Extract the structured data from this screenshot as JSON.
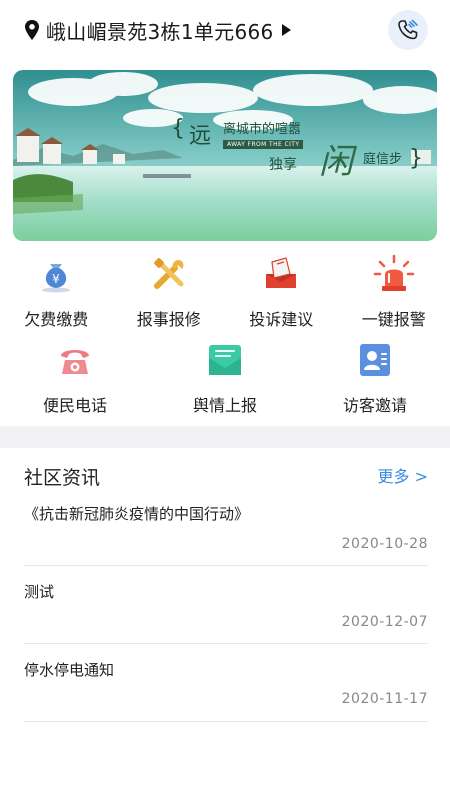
{
  "header": {
    "location": "峨山嵋景苑3栋1单元666"
  },
  "banner": {
    "text_brace_left": "{",
    "text_yuan": "远",
    "text_small": "离城市的喧嚣",
    "text_english": "AWAY FROM THE CITY",
    "text_duxiang": "独享",
    "text_xian": "闲",
    "text_tingxinbu": "庭信步",
    "text_brace_right": "}"
  },
  "services_row1": [
    {
      "label": "欠费缴费",
      "icon": "money-bag-icon"
    },
    {
      "label": "报事报修",
      "icon": "tools-icon"
    },
    {
      "label": "投诉建议",
      "icon": "feedback-icon"
    },
    {
      "label": "一键报警",
      "icon": "alarm-icon"
    }
  ],
  "services_row2": [
    {
      "label": "便民电话",
      "icon": "phone-icon"
    },
    {
      "label": "舆情上报",
      "icon": "mail-report-icon"
    },
    {
      "label": "访客邀请",
      "icon": "visitor-icon"
    }
  ],
  "news": {
    "title": "社区资讯",
    "more": "更多 >",
    "items": [
      {
        "title": "《抗击新冠肺炎疫情的中国行动》",
        "date": "2020-10-28"
      },
      {
        "title": "测试",
        "date": "2020-12-07"
      },
      {
        "title": "停水停电通知",
        "date": "2020-11-17"
      }
    ]
  },
  "colors": {
    "accent_blue": "#3a8ce0",
    "divider_gray": "#f1f1f3"
  }
}
